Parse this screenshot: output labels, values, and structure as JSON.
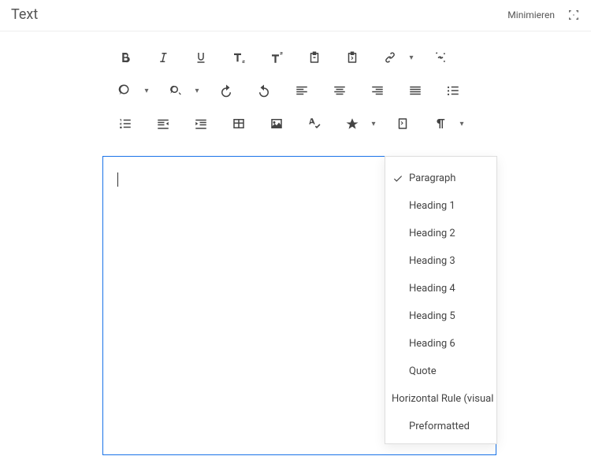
{
  "header": {
    "title": "Text",
    "minimize": "Minimieren"
  },
  "format_menu": {
    "items": [
      {
        "label": "Paragraph",
        "checked": true
      },
      {
        "label": "Heading 1",
        "checked": false
      },
      {
        "label": "Heading 2",
        "checked": false
      },
      {
        "label": "Heading 3",
        "checked": false
      },
      {
        "label": "Heading 4",
        "checked": false
      },
      {
        "label": "Heading 5",
        "checked": false
      },
      {
        "label": "Heading 6",
        "checked": false
      },
      {
        "label": "Quote",
        "checked": false
      },
      {
        "label": "Horizontal Rule (visual l",
        "checked": false
      },
      {
        "label": "Preformatted",
        "checked": false
      }
    ]
  },
  "toolbar": {
    "row1": [
      {
        "name": "bold-icon"
      },
      {
        "name": "italic-icon"
      },
      {
        "name": "underline-icon"
      },
      {
        "name": "subscript-icon"
      },
      {
        "name": "superscript-icon"
      },
      {
        "name": "paste-text-icon"
      },
      {
        "name": "paste-code-icon"
      },
      {
        "name": "link-icon",
        "caret": true
      },
      {
        "name": "unlink-icon"
      }
    ],
    "row2": [
      {
        "name": "find-icon",
        "caret": true
      },
      {
        "name": "find-replace-icon",
        "caret": true
      },
      {
        "name": "undo-icon"
      },
      {
        "name": "redo-icon"
      },
      {
        "name": "align-left-icon"
      },
      {
        "name": "align-center-icon"
      },
      {
        "name": "align-right-icon"
      },
      {
        "name": "align-justify-icon"
      },
      {
        "name": "bullet-list-icon"
      }
    ],
    "row3": [
      {
        "name": "numbered-list-icon"
      },
      {
        "name": "outdent-icon"
      },
      {
        "name": "indent-icon"
      },
      {
        "name": "table-icon"
      },
      {
        "name": "image-icon"
      },
      {
        "name": "spellcheck-icon"
      },
      {
        "name": "special-char-icon",
        "caret": true
      },
      {
        "name": "source-code-icon"
      },
      {
        "name": "paragraph-format-icon",
        "caret": true
      }
    ]
  }
}
